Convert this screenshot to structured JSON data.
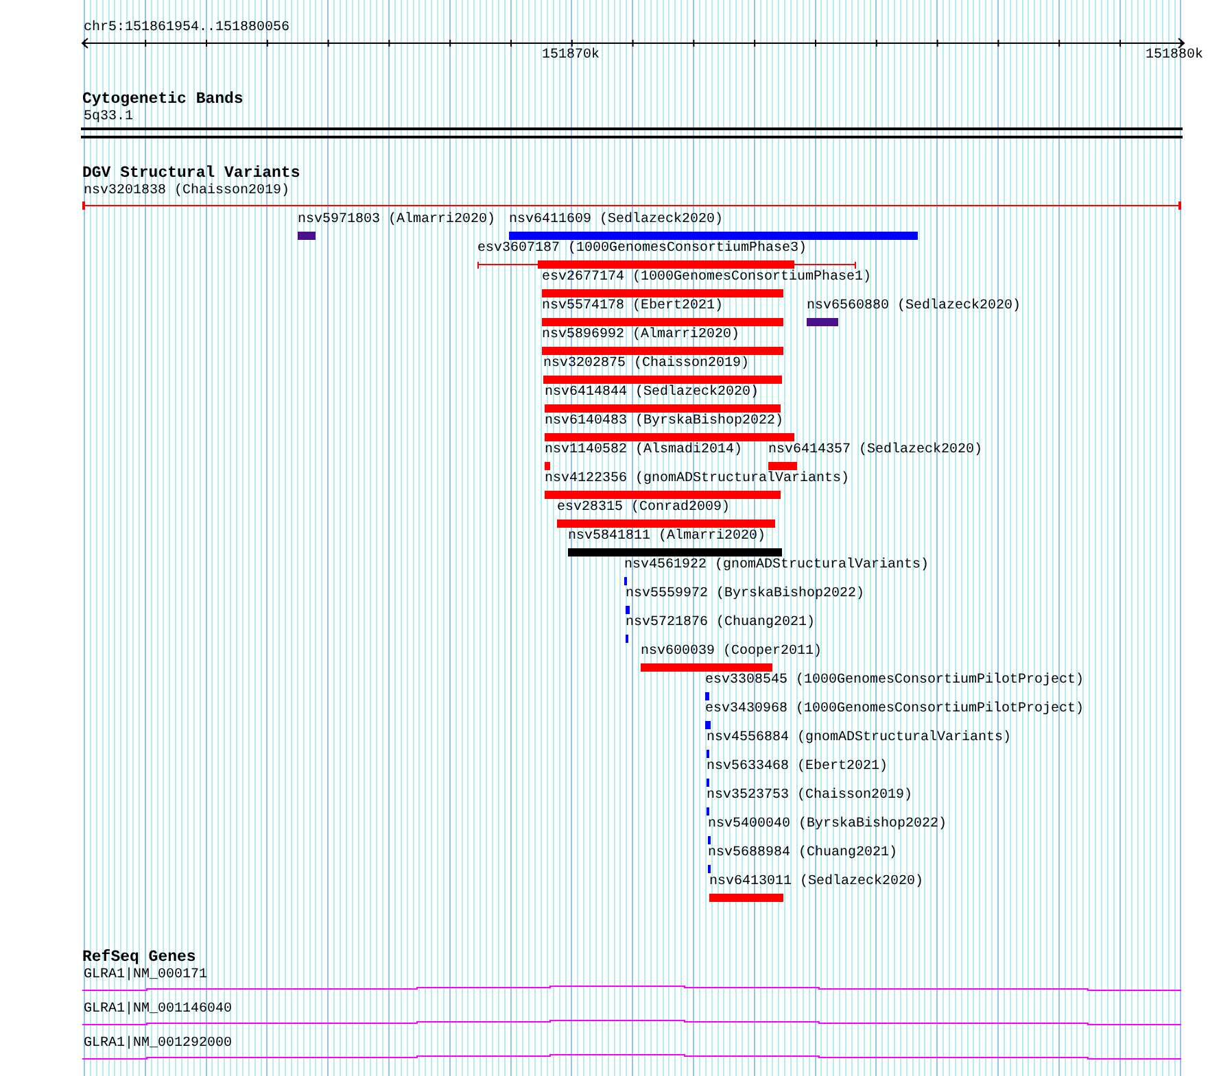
{
  "location": "chr5:151861954..151880056",
  "ruler": {
    "labels": [
      "151870k",
      "151880k"
    ]
  },
  "cytogenetic_bands": {
    "title": "Cytogenetic Bands",
    "bands": [
      {
        "label": "5q33.1"
      }
    ]
  },
  "dgv_track": {
    "title": "DGV Structural Variants",
    "rows": [
      [
        {
          "label": "nsv3201838 (Chaisson2019)",
          "color": "#ff0000",
          "kind": "span"
        }
      ],
      [
        {
          "label": "nsv5971803 (Almarri2020)",
          "color": "#4b0f8c",
          "kind": "bar"
        },
        {
          "label": "nsv6411609 (Sedlazeck2020)",
          "color": "#0000ff",
          "kind": "bar"
        }
      ],
      [
        {
          "label": "esv3607187 (1000GenomesConsortiumPhase3)",
          "color": "#ff0000",
          "kind": "flanked"
        }
      ],
      [
        {
          "label": "esv2677174 (1000GenomesConsortiumPhase1)",
          "color": "#ff0000",
          "kind": "bar"
        }
      ],
      [
        {
          "label": "nsv5574178 (Ebert2021)",
          "color": "#ff0000",
          "kind": "bar"
        },
        {
          "label": "nsv6560880 (Sedlazeck2020)",
          "color": "#4b0f8c",
          "kind": "bar"
        }
      ],
      [
        {
          "label": "nsv5896992 (Almarri2020)",
          "color": "#ff0000",
          "kind": "bar"
        }
      ],
      [
        {
          "label": "nsv3202875 (Chaisson2019)",
          "color": "#ff0000",
          "kind": "bar"
        }
      ],
      [
        {
          "label": "nsv6414844 (Sedlazeck2020)",
          "color": "#ff0000",
          "kind": "bar"
        }
      ],
      [
        {
          "label": "nsv6140483 (ByrskaBishop2022)",
          "color": "#ff0000",
          "kind": "bar"
        }
      ],
      [
        {
          "label": "nsv1140582 (Alsmadi2014)",
          "color": "#ff0000",
          "kind": "bar"
        },
        {
          "label": "nsv6414357 (Sedlazeck2020)",
          "color": "#ff0000",
          "kind": "bar"
        }
      ],
      [
        {
          "label": "nsv4122356 (gnomADStructuralVariants)",
          "color": "#ff0000",
          "kind": "bar"
        }
      ],
      [
        {
          "label": "esv28315 (Conrad2009)",
          "color": "#ff0000",
          "kind": "bar"
        }
      ],
      [
        {
          "label": "nsv5841811 (Almarri2020)",
          "color": "#000000",
          "kind": "bar"
        }
      ],
      [
        {
          "label": "nsv4561922 (gnomADStructuralVariants)",
          "color": "#0000ff",
          "kind": "bar"
        }
      ],
      [
        {
          "label": "nsv5559972 (ByrskaBishop2022)",
          "color": "#0000ff",
          "kind": "bar"
        }
      ],
      [
        {
          "label": "nsv5721876 (Chuang2021)",
          "color": "#0000ff",
          "kind": "bar"
        }
      ],
      [
        {
          "label": "nsv600039 (Cooper2011)",
          "color": "#ff0000",
          "kind": "bar"
        }
      ],
      [
        {
          "label": "esv3308545 (1000GenomesConsortiumPilotProject)",
          "color": "#0000ff",
          "kind": "bar"
        }
      ],
      [
        {
          "label": "esv3430968 (1000GenomesConsortiumPilotProject)",
          "color": "#0000ff",
          "kind": "bar"
        }
      ],
      [
        {
          "label": "nsv4556884 (gnomADStructuralVariants)",
          "color": "#0000ff",
          "kind": "bar"
        }
      ],
      [
        {
          "label": "nsv5633468 (Ebert2021)",
          "color": "#0000ff",
          "kind": "bar"
        }
      ],
      [
        {
          "label": "nsv3523753 (Chaisson2019)",
          "color": "#0000ff",
          "kind": "bar"
        }
      ],
      [
        {
          "label": "nsv5400040 (ByrskaBishop2022)",
          "color": "#0000ff",
          "kind": "bar"
        }
      ],
      [
        {
          "label": "nsv5688984 (Chuang2021)",
          "color": "#0000ff",
          "kind": "bar"
        }
      ],
      [
        {
          "label": "nsv6413011 (Sedlazeck2020)",
          "color": "#ff0000",
          "kind": "bar"
        }
      ]
    ]
  },
  "refseq_track": {
    "title": "RefSeq Genes",
    "transcripts": [
      {
        "label": "GLRA1|NM_000171"
      },
      {
        "label": "GLRA1|NM_001146040"
      },
      {
        "label": "GLRA1|NM_001292000"
      }
    ]
  }
}
